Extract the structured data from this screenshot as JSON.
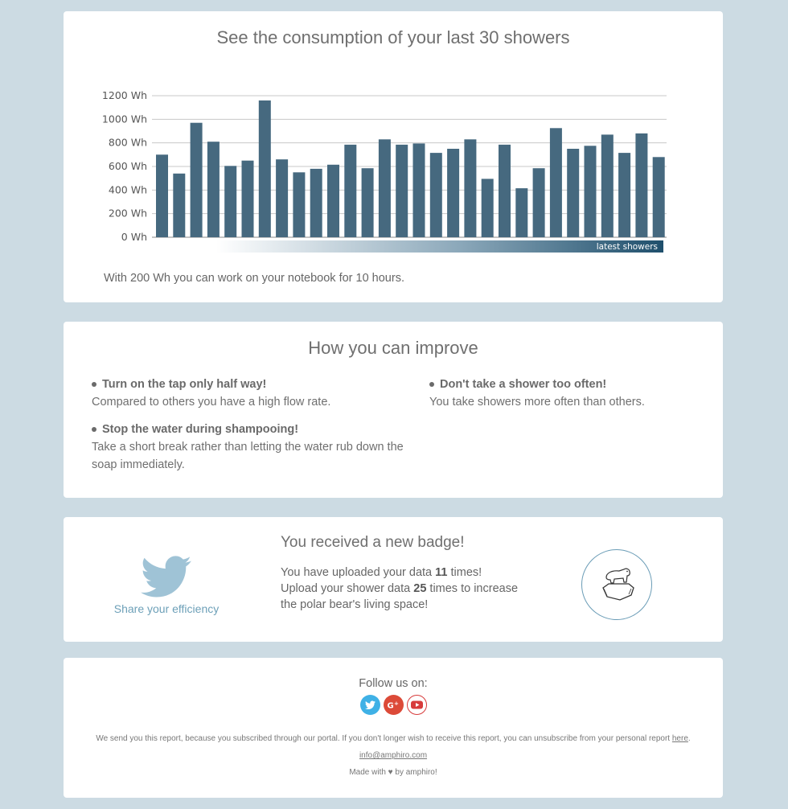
{
  "chart_section": {
    "title": "See the consumption of your last 30 showers",
    "note": "With 200 Wh you can work on your notebook for 10 hours."
  },
  "chart_data": {
    "type": "bar",
    "title": "See the consumption of your last 30 showers",
    "unit": "Wh",
    "ylim": [
      0,
      1200
    ],
    "yticks": [
      "0 Wh",
      "200 Wh",
      "400 Wh",
      "600 Wh",
      "800 Wh",
      "1000 Wh",
      "1200 Wh"
    ],
    "ytick_values": [
      0,
      200,
      400,
      600,
      800,
      1000,
      1200
    ],
    "band_label": "latest showers",
    "bar_color": "#46697f",
    "grid": true,
    "values": [
      700,
      540,
      970,
      810,
      605,
      650,
      1160,
      660,
      550,
      580,
      615,
      785,
      585,
      830,
      785,
      795,
      715,
      750,
      830,
      495,
      785,
      415,
      585,
      925,
      750,
      775,
      870,
      715,
      880,
      680
    ]
  },
  "improve_section": {
    "title": "How you can improve",
    "tips": [
      {
        "title": "Turn on the tap only half way!",
        "body": "Compared to others you have a high flow rate."
      },
      {
        "title": "Don't take a shower too often!",
        "body": "You take showers more often than others."
      },
      {
        "title": "Stop the water during shampooing!",
        "body": "Take a short break rather than letting the water rub down the soap immediately."
      }
    ]
  },
  "badge_section": {
    "share_label": "Share your efficiency",
    "title": "You received a new badge!",
    "line1_prefix": "You have uploaded your data ",
    "uploads": "11",
    "line1_suffix": " times!",
    "line2_prefix": "Upload your shower data ",
    "target": "25",
    "line2_suffix": " times to increase",
    "line3": "the polar bear's living space!",
    "badge_icon": "polar-bear-icon"
  },
  "footer": {
    "follow_label": "Follow us on:",
    "social": [
      "twitter-icon",
      "google-plus-icon",
      "youtube-icon"
    ],
    "disclaimer_text": "We send you this report, because you subscribed through our portal. If you don't longer wish to receive this report, you can unsubscribe from your personal report ",
    "disclaimer_link": "here",
    "disclaimer_end": ".",
    "email": "info@amphiro.com",
    "made_with": "Made with ♥ by amphiro!"
  }
}
